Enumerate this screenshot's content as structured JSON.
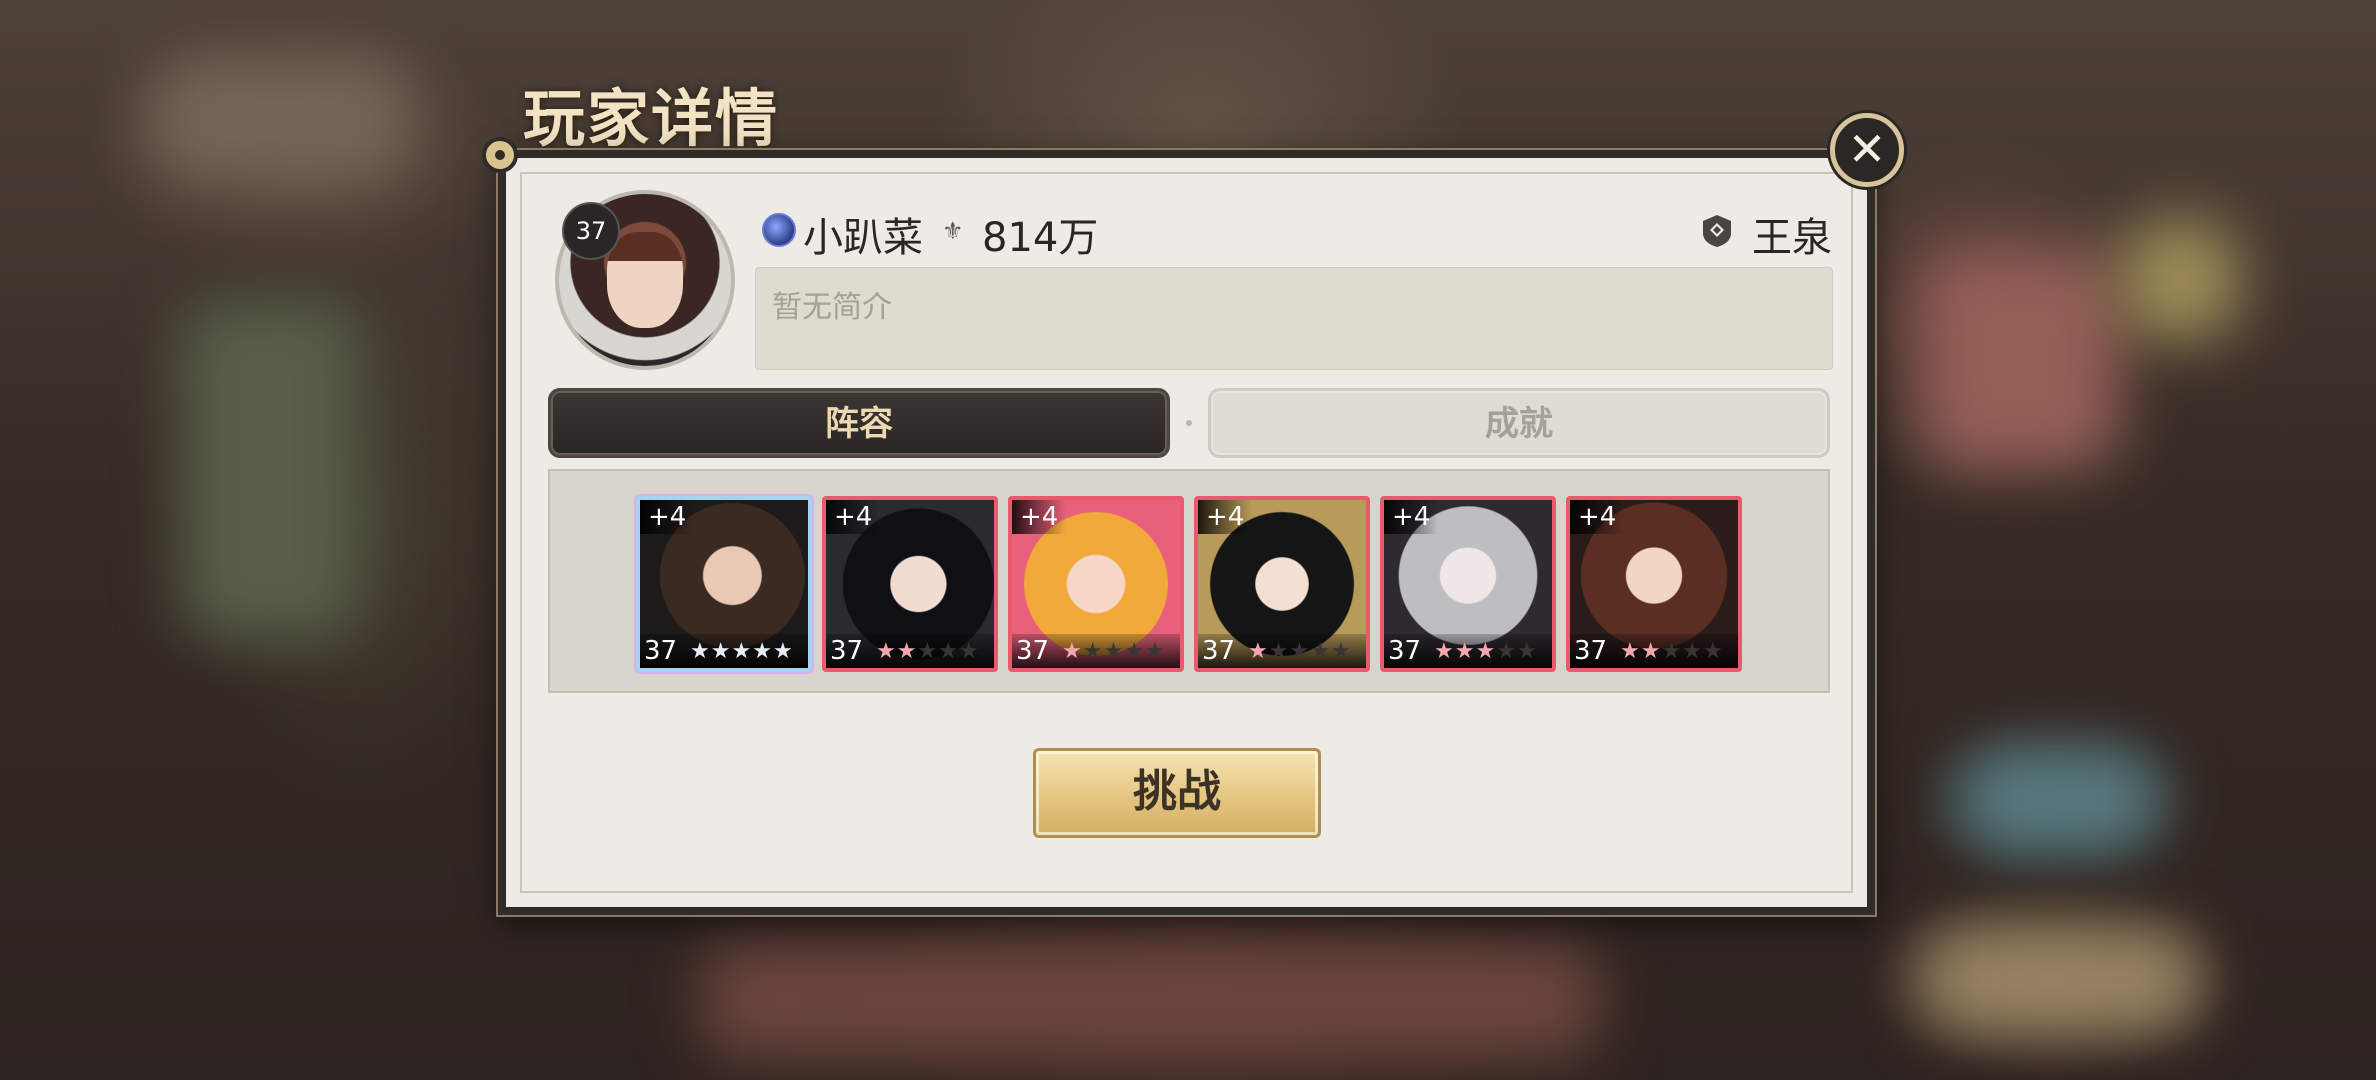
{
  "header": {
    "title": "玩家详情"
  },
  "player": {
    "level": "37",
    "name": "小趴菜",
    "power": "814万",
    "guild": "王泉",
    "bio_placeholder": "暂无简介"
  },
  "tabs": [
    {
      "label": "阵容",
      "active": true
    },
    {
      "label": "成就",
      "active": false
    }
  ],
  "lineup": [
    {
      "plus": "+4",
      "level": "37",
      "stars": 5,
      "star_style": "white",
      "frame": "rainbow"
    },
    {
      "plus": "+4",
      "level": "37",
      "stars": 2,
      "star_style": "pink",
      "frame": "red"
    },
    {
      "plus": "+4",
      "level": "37",
      "stars": 1,
      "star_style": "pink",
      "frame": "red"
    },
    {
      "plus": "+4",
      "level": "37",
      "stars": 1,
      "star_style": "pink",
      "frame": "red"
    },
    {
      "plus": "+4",
      "level": "37",
      "stars": 3,
      "star_style": "pink",
      "frame": "red"
    },
    {
      "plus": "+4",
      "level": "37",
      "stars": 2,
      "star_style": "pink",
      "frame": "red"
    }
  ],
  "actions": {
    "challenge_label": "挑战",
    "close_icon": "close-icon"
  },
  "colors": {
    "accent_gold": "#e4c682",
    "frame_red": "#e95a6e",
    "panel_bg": "#ecebe5"
  }
}
